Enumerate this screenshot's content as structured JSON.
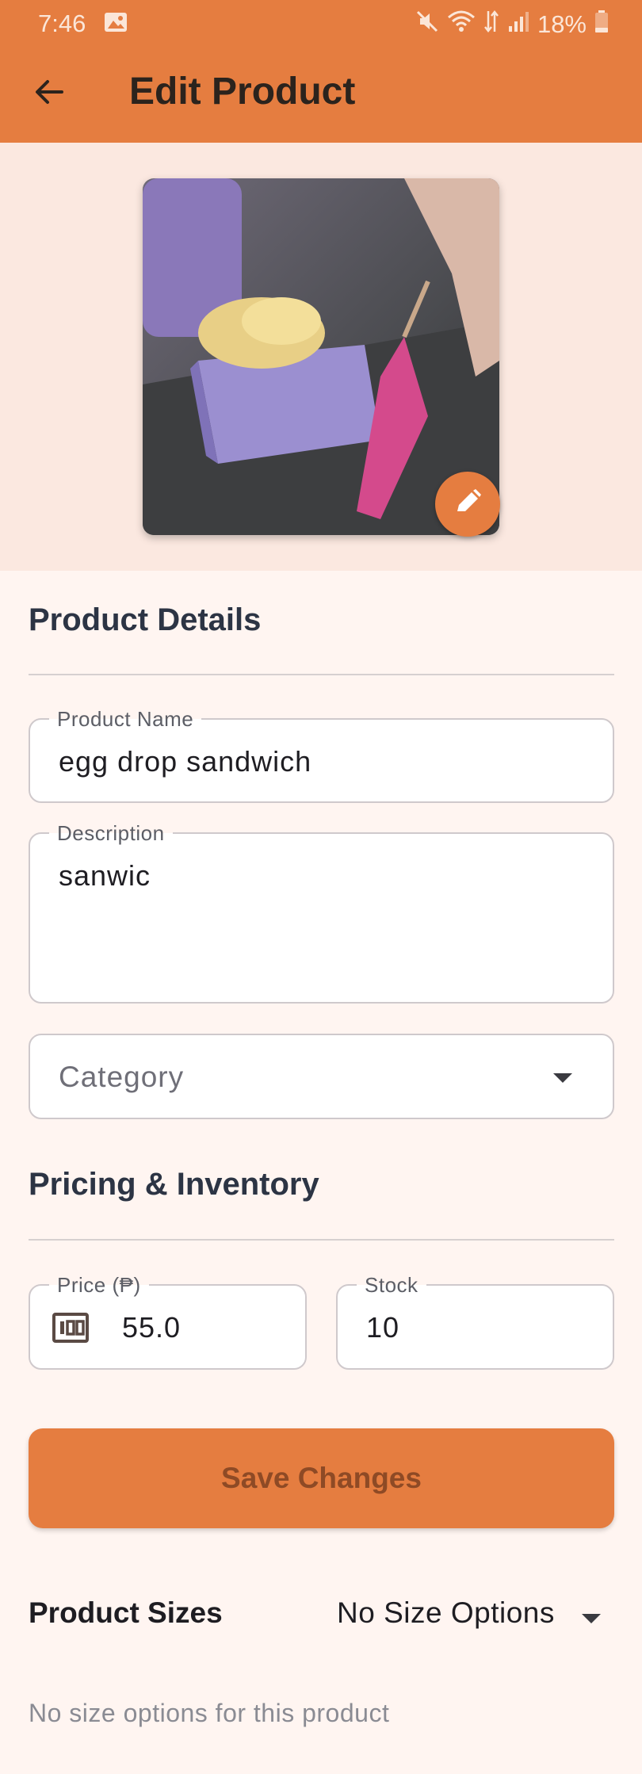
{
  "status_bar": {
    "time": "7:46",
    "battery": "18%"
  },
  "app_bar": {
    "title": "Edit Product",
    "back_icon": "arrow-left-icon",
    "color": "#e57d40"
  },
  "image": {
    "edit_icon": "pencil-icon"
  },
  "product_details": {
    "heading": "Product Details",
    "name_label": "Product Name",
    "name_value": "egg drop sandwich",
    "description_label": "Description",
    "description_value": "sanwic",
    "category_placeholder": "Category"
  },
  "pricing": {
    "heading": "Pricing & Inventory",
    "price_label": "Price (₱)",
    "price_value": "55.0",
    "price_icon": "money-icon",
    "stock_label": "Stock",
    "stock_value": "10"
  },
  "actions": {
    "save_label": "Save Changes"
  },
  "sizes": {
    "heading": "Product Sizes",
    "selected": "No Size Options",
    "empty_message": "No size options for this product"
  }
}
